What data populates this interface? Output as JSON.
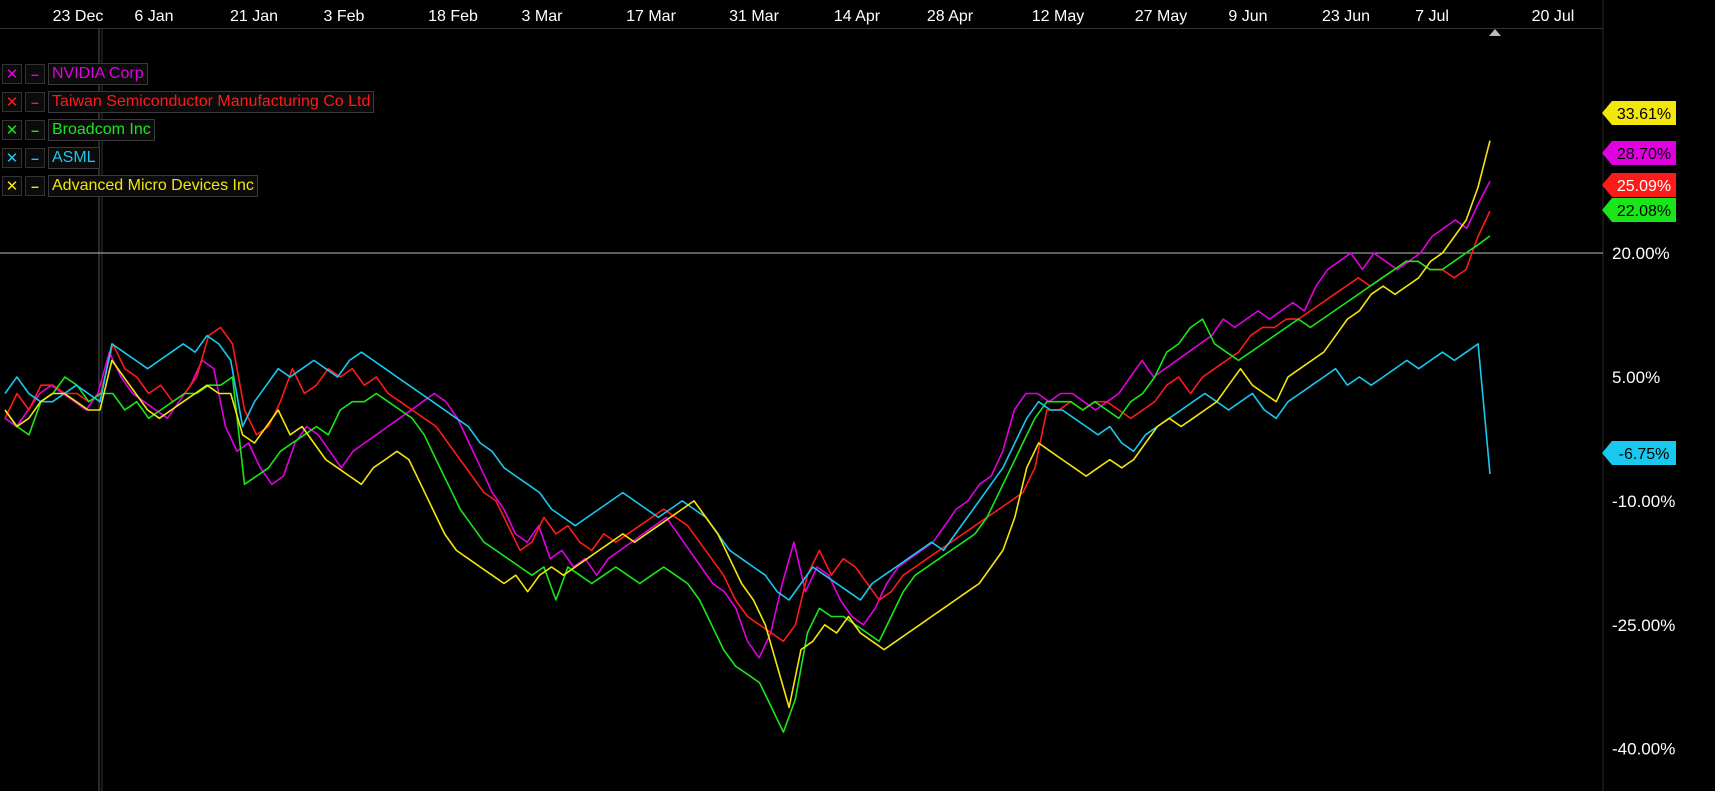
{
  "chart_data": {
    "type": "line",
    "x_ticks": [
      "23 Dec",
      "6 Jan",
      "21 Jan",
      "3 Feb",
      "18 Feb",
      "3 Mar",
      "17 Mar",
      "31 Mar",
      "14 Apr",
      "28 Apr",
      "12 May",
      "27 May",
      "9 Jun",
      "23 Jun",
      "7 Jul",
      "20 Jul"
    ],
    "y_ticks": [
      "20.00%",
      "5.00%",
      "-10.00%",
      "-25.00%",
      "-40.00%"
    ],
    "y_tick_values": [
      20,
      5,
      -10,
      -25,
      -40
    ],
    "ylim": [
      -45,
      47
    ],
    "reference_line": 20,
    "grid": false,
    "legend_position": "top-left",
    "series": [
      {
        "name": "NVIDIA Corp",
        "color": "#e000e0",
        "last_label": "28.70%",
        "values": [
          0,
          -1,
          1,
          3,
          4,
          3,
          2,
          1,
          3,
          8,
          5,
          3,
          2,
          1,
          0,
          2,
          4,
          7,
          6,
          -1,
          -4,
          -3,
          -6,
          -8,
          -7,
          -3,
          -1,
          -2,
          -4,
          -6,
          -4,
          -3,
          -2,
          -1,
          0,
          1,
          2,
          3,
          2,
          0,
          -3,
          -6,
          -9,
          -11,
          -14,
          -15,
          -13,
          -17,
          -16,
          -18,
          -17,
          -19,
          -17,
          -16,
          -15,
          -14,
          -13,
          -12,
          -14,
          -16,
          -18,
          -20,
          -21,
          -23,
          -27,
          -29,
          -26,
          -20,
          -15,
          -21,
          -18,
          -19,
          -22,
          -24,
          -25,
          -23,
          -20,
          -18,
          -17,
          -16,
          -15,
          -13,
          -11,
          -10,
          -8,
          -7,
          -4,
          1,
          3,
          3,
          2,
          3,
          3,
          2,
          1,
          2,
          3,
          5,
          7,
          5,
          6,
          7,
          8,
          9,
          10,
          12,
          11,
          12,
          13,
          12,
          13,
          14,
          13,
          16,
          18,
          19,
          20,
          18,
          20,
          19,
          18,
          19,
          20,
          22,
          23,
          24,
          23,
          26,
          28.7
        ]
      },
      {
        "name": "Taiwan Semiconductor Manufacturing Co Ltd",
        "color": "#ff1a1a",
        "last_label": "25.09%",
        "values": [
          0,
          3,
          1,
          4,
          4,
          3,
          3,
          2,
          3,
          9,
          6,
          5,
          3,
          4,
          2,
          3,
          5,
          10,
          11,
          9,
          1,
          -2,
          -1,
          2,
          6,
          3,
          4,
          6,
          5,
          6,
          4,
          5,
          3,
          2,
          1,
          0,
          -1,
          -3,
          -5,
          -7,
          -9,
          -10,
          -13,
          -16,
          -15,
          -12,
          -14,
          -13,
          -15,
          -16,
          -14,
          -15,
          -14,
          -13,
          -12,
          -11,
          -12,
          -13,
          -15,
          -17,
          -19,
          -22,
          -24,
          -25,
          -26,
          -27,
          -25,
          -19,
          -16,
          -19,
          -17,
          -18,
          -20,
          -22,
          -21,
          -19,
          -18,
          -17,
          -16,
          -15,
          -14,
          -13,
          -12,
          -11,
          -10,
          -9,
          -6,
          1,
          1,
          2,
          1,
          2,
          2,
          1,
          0,
          1,
          2,
          4,
          5,
          3,
          5,
          6,
          7,
          8,
          10,
          11,
          11,
          12,
          12,
          13,
          14,
          15,
          16,
          17,
          16,
          17,
          18,
          19,
          19,
          18,
          18,
          17,
          18,
          22,
          25.09
        ]
      },
      {
        "name": "Broadcom Inc",
        "color": "#19e619",
        "last_label": "22.08%",
        "values": [
          1,
          -1,
          -2,
          2,
          3,
          5,
          4,
          2,
          3,
          3,
          1,
          2,
          0,
          1,
          2,
          3,
          3,
          4,
          4,
          5,
          -8,
          -7,
          -6,
          -4,
          -3,
          -2,
          -1,
          -2,
          1,
          2,
          2,
          3,
          2,
          1,
          0,
          -2,
          -5,
          -8,
          -11,
          -13,
          -15,
          -16,
          -17,
          -18,
          -19,
          -18,
          -22,
          -18,
          -19,
          -20,
          -19,
          -18,
          -19,
          -20,
          -19,
          -18,
          -19,
          -20,
          -22,
          -25,
          -28,
          -30,
          -31,
          -32,
          -35,
          -38,
          -34,
          -26,
          -23,
          -24,
          -24,
          -25,
          -26,
          -27,
          -24,
          -21,
          -19,
          -18,
          -17,
          -16,
          -15,
          -14,
          -12,
          -9,
          -6,
          -3,
          0,
          2,
          2,
          2,
          1,
          2,
          1,
          0,
          2,
          3,
          5,
          8,
          9,
          11,
          12,
          9,
          8,
          7,
          8,
          9,
          10,
          11,
          12,
          11,
          12,
          13,
          14,
          15,
          16,
          17,
          18,
          19,
          19,
          18,
          18,
          19,
          20,
          21,
          22.08
        ]
      },
      {
        "name": "ASML",
        "color": "#19c8ee",
        "last_label": "-6.75%",
        "values": [
          3,
          5,
          3,
          2,
          2,
          3,
          4,
          3,
          2,
          9,
          8,
          7,
          6,
          7,
          8,
          9,
          8,
          10,
          9,
          7,
          -1,
          2,
          4,
          6,
          5,
          6,
          7,
          6,
          5,
          7,
          8,
          7,
          6,
          5,
          4,
          3,
          2,
          1,
          0,
          -1,
          -3,
          -4,
          -6,
          -7,
          -8,
          -9,
          -11,
          -12,
          -13,
          -12,
          -11,
          -10,
          -9,
          -10,
          -11,
          -12,
          -11,
          -10,
          -11,
          -12,
          -14,
          -16,
          -17,
          -18,
          -19,
          -21,
          -22,
          -20,
          -18,
          -19,
          -20,
          -21,
          -22,
          -20,
          -19,
          -18,
          -17,
          -16,
          -15,
          -16,
          -14,
          -12,
          -10,
          -8,
          -6,
          -3,
          0,
          2,
          1,
          1,
          0,
          -1,
          -2,
          -1,
          -3,
          -4,
          -2,
          -1,
          0,
          1,
          2,
          3,
          2,
          1,
          2,
          3,
          1,
          0,
          2,
          3,
          4,
          5,
          6,
          4,
          5,
          4,
          5,
          6,
          7,
          6,
          7,
          8,
          7,
          8,
          9,
          -6.75
        ]
      },
      {
        "name": "Advanced Micro Devices Inc",
        "color": "#f2e60d",
        "last_label": "33.61%",
        "values": [
          1,
          -1,
          0,
          2,
          3,
          3,
          2,
          1,
          1,
          7,
          5,
          3,
          1,
          0,
          1,
          2,
          3,
          4,
          3,
          3,
          -2,
          -3,
          -1,
          1,
          -2,
          -1,
          -3,
          -5,
          -6,
          -7,
          -8,
          -6,
          -5,
          -4,
          -5,
          -8,
          -11,
          -14,
          -16,
          -17,
          -18,
          -19,
          -20,
          -19,
          -21,
          -19,
          -18,
          -19,
          -18,
          -17,
          -16,
          -15,
          -14,
          -15,
          -14,
          -13,
          -12,
          -11,
          -10,
          -12,
          -14,
          -17,
          -20,
          -22,
          -25,
          -30,
          -35,
          -28,
          -27,
          -25,
          -26,
          -24,
          -26,
          -27,
          -28,
          -27,
          -26,
          -25,
          -24,
          -23,
          -22,
          -21,
          -20,
          -18,
          -16,
          -12,
          -6,
          -3,
          -4,
          -5,
          -6,
          -7,
          -6,
          -5,
          -6,
          -5,
          -3,
          -1,
          0,
          -1,
          0,
          1,
          2,
          4,
          6,
          4,
          3,
          2,
          5,
          6,
          7,
          8,
          10,
          12,
          13,
          15,
          16,
          15,
          16,
          17,
          19,
          20,
          22,
          24,
          28,
          33.61
        ]
      }
    ]
  },
  "legend_icons": {
    "remove": "✕",
    "style": "–"
  },
  "badges": [
    {
      "text": "33.61%",
      "bg": "#f2e60d",
      "fg": "#000",
      "value": 33.61
    },
    {
      "text": "28.70%",
      "bg": "#e000e0",
      "fg": "#000",
      "value": 28.7
    },
    {
      "text": "25.09%",
      "bg": "#ff1a1a",
      "fg": "#fff",
      "value": 25.09
    },
    {
      "text": "22.08%",
      "bg": "#19e619",
      "fg": "#000",
      "value": 22.08
    },
    {
      "text": "-6.75%",
      "bg": "#19c8ee",
      "fg": "#000",
      "value": -6.75
    }
  ]
}
